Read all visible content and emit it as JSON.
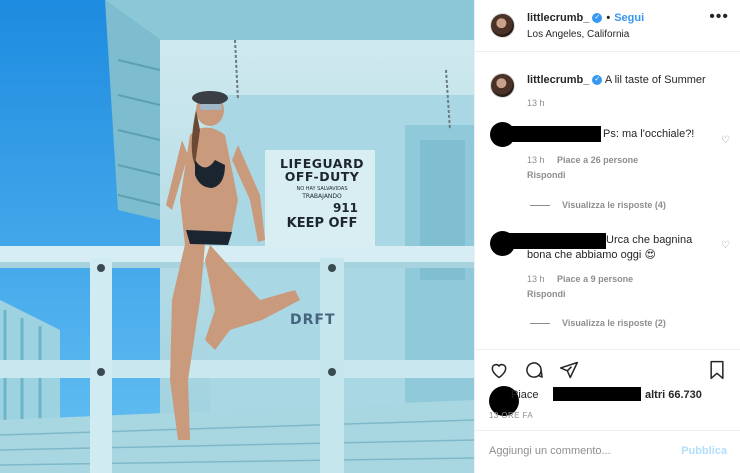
{
  "photo": {
    "sign_lines": [
      "LIFEGUARD",
      "OFF-DUTY",
      "NO HAY SALVAVIDAS",
      "TRABAJANDO",
      "911",
      "KEEP OFF"
    ],
    "lower_text": "DRFT"
  },
  "header": {
    "username": "littlecrumb_",
    "verified_icon": "verified-badge-icon",
    "separator": "•",
    "follow_label": "Segui",
    "location": "Los Angeles, California",
    "more_icon": "more-options-icon"
  },
  "caption": {
    "username": "littlecrumb_",
    "text": "A lil taste of Summer",
    "time": "13 h"
  },
  "comments": [
    {
      "text": "Ps: ma l'occhiale?!",
      "time": "13 h",
      "likes": "Piace a 26 persone",
      "reply_label": "Rispondi",
      "view_replies": "Visualizza le risposte (4)"
    },
    {
      "text_line1": "Urca che bagnina",
      "text_line2": "bona che abbiamo oggi",
      "emoji": "😍",
      "time": "13 h",
      "likes": "Piace a 9 persone",
      "reply_label": "Rispondi",
      "view_replies": "Visualizza le risposte (2)"
    }
  ],
  "likes": {
    "prefix": "Piace",
    "suffix": "altri 66.730"
  },
  "timeago": "13 ORE FA",
  "add_comment": {
    "placeholder": "Aggiungi un commento...",
    "publish_label": "Pubblica"
  },
  "colors": {
    "accent": "#3897f0",
    "muted": "#8e8e8e",
    "publish_disabled": "#b2dffc",
    "emoji_like": "#e0245e"
  }
}
